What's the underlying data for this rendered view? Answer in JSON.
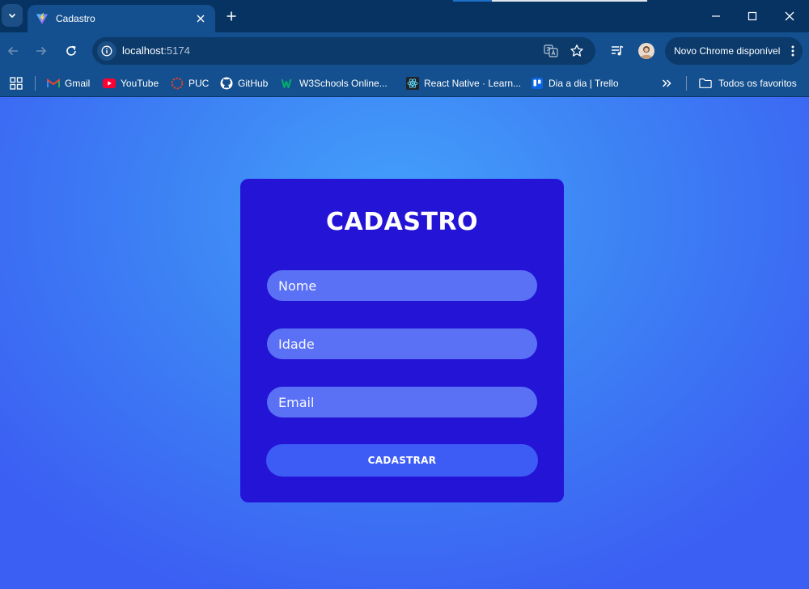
{
  "browser": {
    "tab": {
      "title": "Cadastro"
    },
    "url": {
      "host": "localhost",
      "port": ":5174"
    },
    "update_button": "Novo Chrome disponível",
    "bookmarks": [
      {
        "label": "Gmail",
        "icon": "gmail-icon"
      },
      {
        "label": "YouTube",
        "icon": "youtube-icon"
      },
      {
        "label": "PUC",
        "icon": "puc-icon"
      },
      {
        "label": "GitHub",
        "icon": "github-icon"
      },
      {
        "label": "W3Schools Online...",
        "icon": "w3schools-icon"
      },
      {
        "label": "React Native · Learn...",
        "icon": "react-icon"
      },
      {
        "label": "Dia a dia | Trello",
        "icon": "trello-icon"
      }
    ],
    "all_bookmarks": "Todos os favoritos",
    "colors": {
      "frame": "#073363",
      "toolbar": "#14508f",
      "omnibox": "#0b3a6b"
    }
  },
  "page": {
    "title": "CADASTRO",
    "fields": {
      "nome": {
        "placeholder": "Nome",
        "value": ""
      },
      "idade": {
        "placeholder": "Idade",
        "value": ""
      },
      "email": {
        "placeholder": "Email",
        "value": ""
      }
    },
    "submit_label": "CADASTRAR",
    "colors": {
      "card": "#2415d6",
      "field": "#5a71f6",
      "button": "#3d5cf6",
      "background_center": "#44a0fb",
      "background_edge": "#3b5ef3"
    }
  }
}
